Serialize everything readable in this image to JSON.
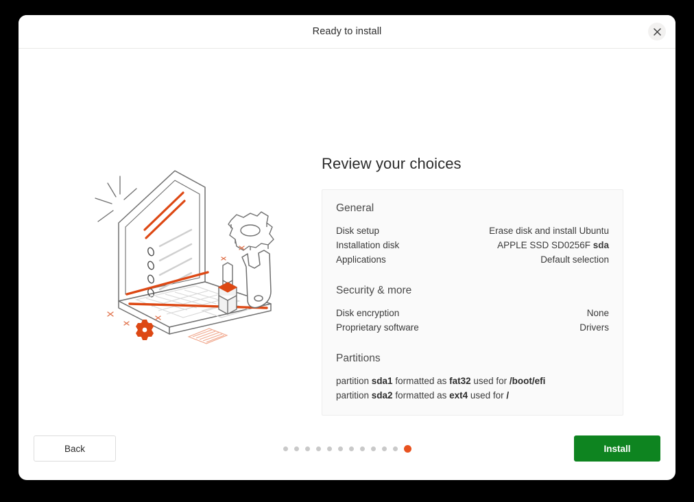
{
  "window": {
    "title": "Ready to install",
    "close_icon": "close-icon"
  },
  "main": {
    "heading": "Review your choices"
  },
  "summary": {
    "sections": [
      {
        "heading": "General",
        "rows": [
          {
            "key": "Disk setup",
            "value": "Erase disk and install Ubuntu",
            "value_bold": ""
          },
          {
            "key": "Installation disk",
            "value": "APPLE SSD SD0256F ",
            "value_bold": "sda"
          },
          {
            "key": "Applications",
            "value": "Default selection",
            "value_bold": ""
          }
        ]
      },
      {
        "heading": "Security & more",
        "rows": [
          {
            "key": "Disk encryption",
            "value": "None",
            "value_bold": ""
          },
          {
            "key": "Proprietary software",
            "value": "Drivers",
            "value_bold": ""
          }
        ]
      }
    ],
    "partitions_heading": "Partitions",
    "partitions": [
      {
        "prefix": "partition ",
        "device": "sda1",
        "mid": " formatted as ",
        "fs": "fat32",
        "suffix": " used for ",
        "mount": "/boot/efi"
      },
      {
        "prefix": "partition ",
        "device": "sda2",
        "mid": " formatted as ",
        "fs": "ext4",
        "suffix": " used for ",
        "mount": "/"
      }
    ]
  },
  "footer": {
    "back_label": "Back",
    "install_label": "Install",
    "pagination": {
      "total": 12,
      "active_index": 11
    }
  },
  "colors": {
    "accent_orange": "#e8521f",
    "install_green": "#0e8420",
    "panel_background": "#fafafa",
    "panel_border": "#ededed",
    "window_background": "#ffffff",
    "desktop_background": "#000000",
    "illustration_line": "#6e6e6e",
    "illustration_accent": "#dd4814"
  },
  "illustration": {
    "name": "installer-review-illustration",
    "elements": [
      "laptop",
      "checklist",
      "gear-outline",
      "wrench",
      "screwdriver",
      "small-gear",
      "sparkle"
    ]
  }
}
